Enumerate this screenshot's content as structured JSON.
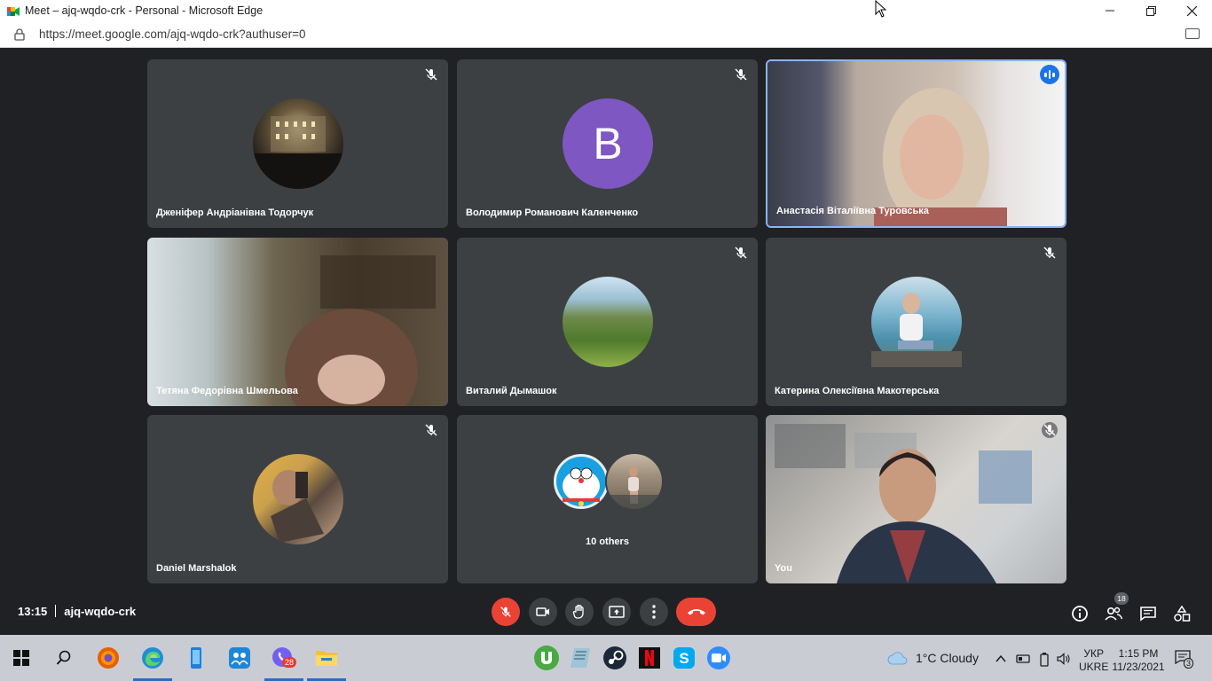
{
  "window": {
    "title": "Meet – ajq-wqdo-crk - Personal - Microsoft Edge",
    "url": "https://meet.google.com/ajq-wqdo-crk?authuser=0"
  },
  "participants": [
    {
      "name": "Дженіфер Андріанівна Тодорчук",
      "type": "avatar-photo",
      "muted": true
    },
    {
      "name": "Володимир Романович Каленченко",
      "type": "avatar-letter",
      "initial": "B",
      "avatar_color": "#7e57c2",
      "muted": true
    },
    {
      "name": "Анастасія Віталіївна Туровська",
      "type": "video",
      "muted": false,
      "speaking": true
    },
    {
      "name": "Тетяна Федорівна Шмельова",
      "type": "video",
      "muted": false
    },
    {
      "name": "Виталий Дымашок",
      "type": "avatar-photo",
      "muted": true
    },
    {
      "name": "Катерина Олексіївна Макотерська",
      "type": "avatar-photo",
      "muted": true
    },
    {
      "name": "Daniel Marshalok",
      "type": "avatar-photo",
      "muted": true
    },
    {
      "name": "10 others",
      "type": "others"
    },
    {
      "name": "You",
      "type": "video",
      "muted": true
    }
  ],
  "controls": {
    "time": "13:15",
    "meeting_code": "ajq-wqdo-crk",
    "people_count": "18"
  },
  "taskbar": {
    "viber_badge": "28",
    "weather": "1°C  Cloudy",
    "lang_top": "УКР",
    "lang_bottom": "UKRE",
    "clock_time": "1:15 PM",
    "clock_date": "11/23/2021",
    "notifications": "3"
  },
  "colors": {
    "background": "#202124",
    "tile": "#3c4043",
    "accent": "#1a73e8",
    "danger": "#ea4335"
  }
}
